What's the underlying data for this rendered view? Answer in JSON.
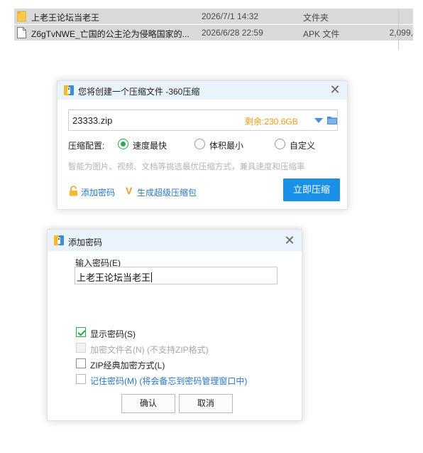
{
  "files": [
    {
      "name": "上老王论坛当老王",
      "date": "2026/7/1 14:32",
      "type": "文件夹",
      "size": "",
      "icon": "folder-icon"
    },
    {
      "name": "Z6gTvNWE_亡国的公主沦为侵略国家的...",
      "date": "2026/6/28 22:59",
      "type": "APK 文件",
      "size": "2,099,",
      "icon": "file-icon"
    }
  ],
  "compress_dialog": {
    "title": "您将创建一个压缩文件 -360压缩",
    "path_value": "23333.zip",
    "free_space": "剩余:230.6GB",
    "config_label": "压缩配置:",
    "options": [
      "速度最快",
      "体积最小",
      "自定义"
    ],
    "selected_option": "速度最快",
    "hint": "智能为图片、视频、文档等挑选最优压缩方式，兼具速度和压缩率",
    "add_password_link": "添加密码",
    "super_compress_link": "生成超级压缩包",
    "compress_button": "立即压缩",
    "accent_color": "#1a90e6",
    "free_space_color": "#f39a1e"
  },
  "password_dialog": {
    "title": "添加密码",
    "input_label": "输入密码(E)",
    "input_value": "上老王论坛当老王",
    "checkboxes": [
      {
        "label": "显示密码(S)",
        "checked": true,
        "disabled": false
      },
      {
        "label": "加密文件名(N) (不支持ZIP格式)",
        "checked": false,
        "disabled": true
      },
      {
        "label": "ZIP经典加密方式(L)",
        "checked": false,
        "disabled": false
      },
      {
        "label": "记住密码(M) (将会备忘到密码管理窗口中)",
        "checked": false,
        "disabled": false
      }
    ],
    "ok_button": "确认",
    "cancel_button": "取消"
  }
}
